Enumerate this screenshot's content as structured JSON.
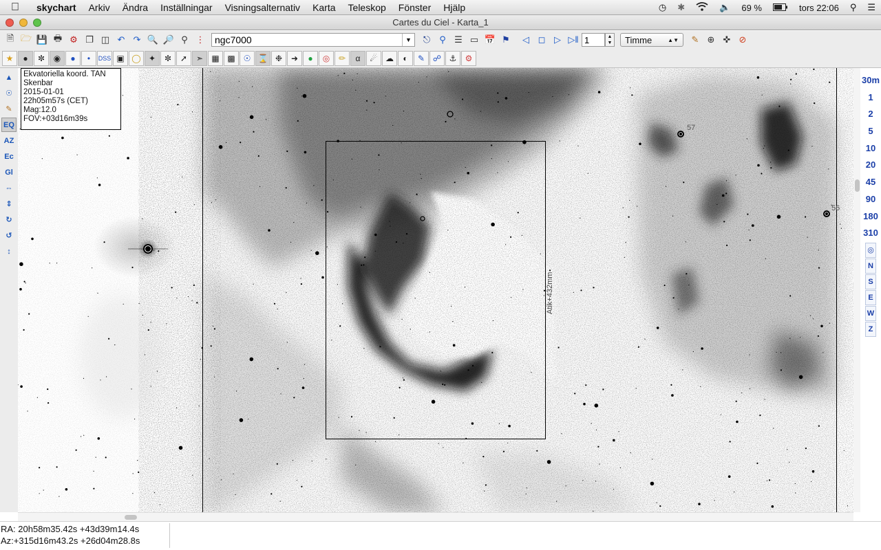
{
  "menubar": {
    "app": "skychart",
    "items": [
      "Arkiv",
      "Ändra",
      "Inställningar",
      "Visningsalternativ",
      "Karta",
      "Teleskop",
      "Fönster",
      "Hjälp"
    ],
    "battery": "69 %",
    "clock": "tors 22:06"
  },
  "window": {
    "title": "Cartes du Ciel - Karta_1"
  },
  "toolbar": {
    "search_value": "ngc7000",
    "step_value": "1",
    "time_unit": "Timme"
  },
  "chart": {
    "info_lines": [
      "Ekvatoriella koord. TAN",
      "Skenbar",
      "2015-01-01",
      "22h05m57s (CET)",
      "Mag:12.0",
      "FOV:+03d16m39s"
    ],
    "fov_label": "Atik+432mm",
    "star_labels": [
      "57",
      "56"
    ]
  },
  "fov_buttons": [
    "30m",
    "1",
    "2",
    "5",
    "10",
    "20",
    "45",
    "90",
    "180",
    "310"
  ],
  "direction_buttons": [
    "N",
    "S",
    "E",
    "W",
    "Z"
  ],
  "left_tools": [
    "EQ",
    "AZ",
    "Ec",
    "Gl"
  ],
  "status": {
    "ra_dec": "RA: 20h58m35.42s +43d39m14.4s",
    "az_alt": "Az:+315d16m43.2s +26d04m28.8s"
  }
}
